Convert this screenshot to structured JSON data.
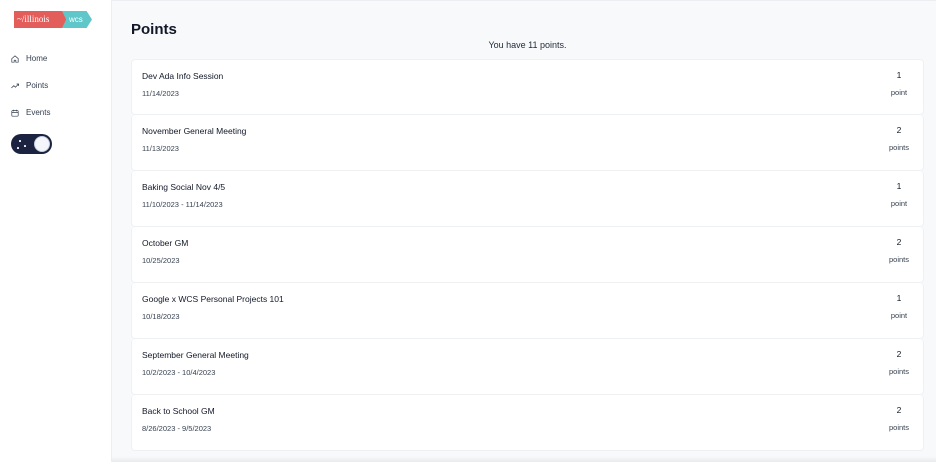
{
  "sidebar": {
    "logo": {
      "left": "~/illinois",
      "right": "wcs"
    },
    "items": [
      {
        "label": "Home",
        "icon": "home-icon"
      },
      {
        "label": "Points",
        "icon": "trending-up-icon"
      },
      {
        "label": "Events",
        "icon": "calendar-icon"
      }
    ],
    "theme_toggle": {
      "state": "dark"
    }
  },
  "main": {
    "title": "Points",
    "summary": "You have 11 points.",
    "events": [
      {
        "name": "Dev Ada Info Session",
        "date": "11/14/2023",
        "points": "1",
        "unit": "point"
      },
      {
        "name": "November General Meeting",
        "date": "11/13/2023",
        "points": "2",
        "unit": "points"
      },
      {
        "name": "Baking Social Nov 4/5",
        "date": "11/10/2023 - 11/14/2023",
        "points": "1",
        "unit": "point"
      },
      {
        "name": "October GM",
        "date": "10/25/2023",
        "points": "2",
        "unit": "points"
      },
      {
        "name": "Google x WCS Personal Projects 101",
        "date": "10/18/2023",
        "points": "1",
        "unit": "point"
      },
      {
        "name": "September General Meeting",
        "date": "10/2/2023 - 10/4/2023",
        "points": "2",
        "unit": "points"
      },
      {
        "name": "Back to School GM",
        "date": "8/26/2023 - 9/5/2023",
        "points": "2",
        "unit": "points"
      }
    ]
  },
  "colors": {
    "logo_left": "#e35d5b",
    "logo_right": "#5fc7c9",
    "toggle_bg": "#1b2340"
  }
}
